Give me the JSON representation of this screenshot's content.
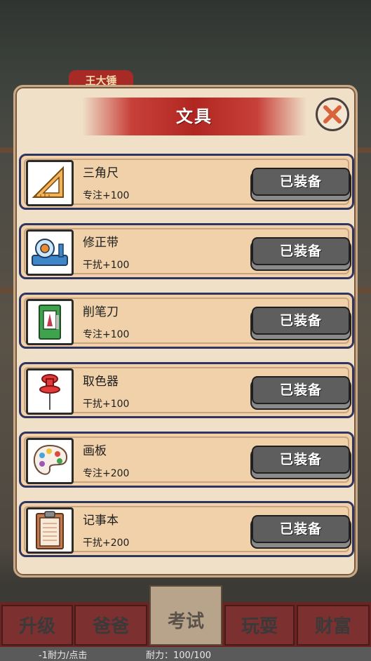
{
  "background": {
    "name_tag": "王大锤"
  },
  "modal": {
    "title": "文具",
    "items": [
      {
        "name": "三角尺",
        "stat": "专注+100",
        "button": "已装备",
        "icon": "ruler-icon"
      },
      {
        "name": "修正带",
        "stat": "干扰+100",
        "button": "已装备",
        "icon": "correction-tape-icon"
      },
      {
        "name": "削笔刀",
        "stat": "专注+100",
        "button": "已装备",
        "icon": "pencil-sharpener-icon"
      },
      {
        "name": "取色器",
        "stat": "干扰+100",
        "button": "已装备",
        "icon": "push-pin-icon"
      },
      {
        "name": "画板",
        "stat": "专注+200",
        "button": "已装备",
        "icon": "palette-icon"
      },
      {
        "name": "记事本",
        "stat": "干扰+200",
        "button": "已装备",
        "icon": "clipboard-icon"
      }
    ]
  },
  "nav": {
    "tabs": [
      {
        "label": "升级"
      },
      {
        "label": "爸爸"
      },
      {
        "label": "考试"
      },
      {
        "label": "玩耍"
      },
      {
        "label": "财富"
      }
    ]
  },
  "status": {
    "cost": "-1耐力/点击",
    "stamina": "耐力：100/100"
  },
  "colors": {
    "title_red": "#b12621",
    "modal_bg": "#efe0c7",
    "row_bg": "#f0d1aa",
    "button_gray": "#5e5e5e"
  }
}
